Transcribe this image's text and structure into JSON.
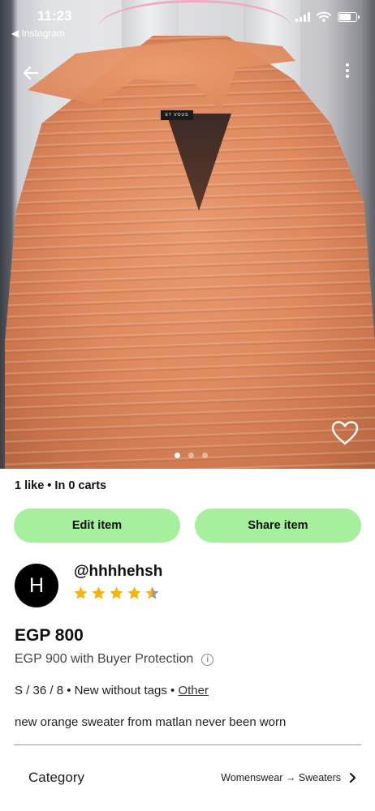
{
  "status_bar": {
    "time": "11:23",
    "back_app": "◀ Instagram"
  },
  "photo": {
    "carousel_count": 3,
    "carousel_active_index": 0
  },
  "item": {
    "stats": "1 like • In 0 carts",
    "actions": {
      "edit_label": "Edit item",
      "share_label": "Share item"
    },
    "seller": {
      "avatar_initial": "H",
      "username": "@hhhhehsh",
      "rating": 4.5,
      "rating_max": 5
    },
    "price": "EGP 800",
    "buyer_protection_price": "EGP 900 with Buyer Protection",
    "attributes_text": "S / 36 / 8 • New without tags • ",
    "attributes_link": "Other",
    "description": "new orange sweater from matlan never been worn",
    "category": {
      "label": "Category",
      "value": "Womenswear → Sweaters"
    }
  },
  "colors": {
    "action_button": "#a6ef9c",
    "star": "#f5b800"
  },
  "icons": [
    "back-arrow-icon",
    "more-vertical-icon",
    "heart-icon",
    "info-icon",
    "chevron-right-icon",
    "star-icon",
    "signal-icon",
    "wifi-icon",
    "battery-icon"
  ]
}
